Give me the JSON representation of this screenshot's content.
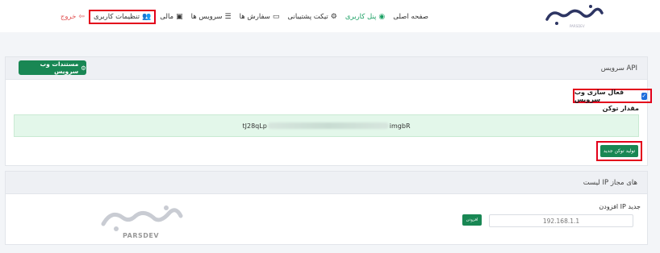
{
  "brand": {
    "logo_text": "پارسدو",
    "logo_subtext": "PARSDEV",
    "watermark_text": "PARSDEV"
  },
  "nav": {
    "items": [
      {
        "label": "صفحه اصلی",
        "icon": ""
      },
      {
        "label": "پنل کاربری",
        "icon": "user-circle-icon"
      },
      {
        "label": "تیکت پشتیبانی",
        "icon": "support-icon"
      },
      {
        "label": "سفارش ها",
        "icon": "orders-icon"
      },
      {
        "label": "سرویس ها",
        "icon": "services-icon"
      },
      {
        "label": "مالی",
        "icon": "wallet-icon"
      },
      {
        "label": "تنظیمات کاربری",
        "icon": "users-settings-icon"
      },
      {
        "label": "خروج",
        "icon": "logout-icon"
      }
    ]
  },
  "api_card": {
    "title": "سرویس API",
    "docs_button": "مستندات وب سرویس",
    "enable_label": "فعال سازی وب سرویس",
    "enable_checked": true,
    "token_label": "مقدار توکن",
    "token_start": "tJ28qLp",
    "token_end": "imgbR",
    "generate_button": "تولید توکن جدید"
  },
  "ip_card": {
    "title": "لیست IP های مجاز",
    "add_label": "افزودن IP جدید",
    "ip_placeholder": "192.168.1.1",
    "add_button": "افزودن"
  },
  "colors": {
    "accent": "#198754",
    "highlight": "#e3001b",
    "danger": "#e15353",
    "token_bg": "#e3f7ea"
  }
}
